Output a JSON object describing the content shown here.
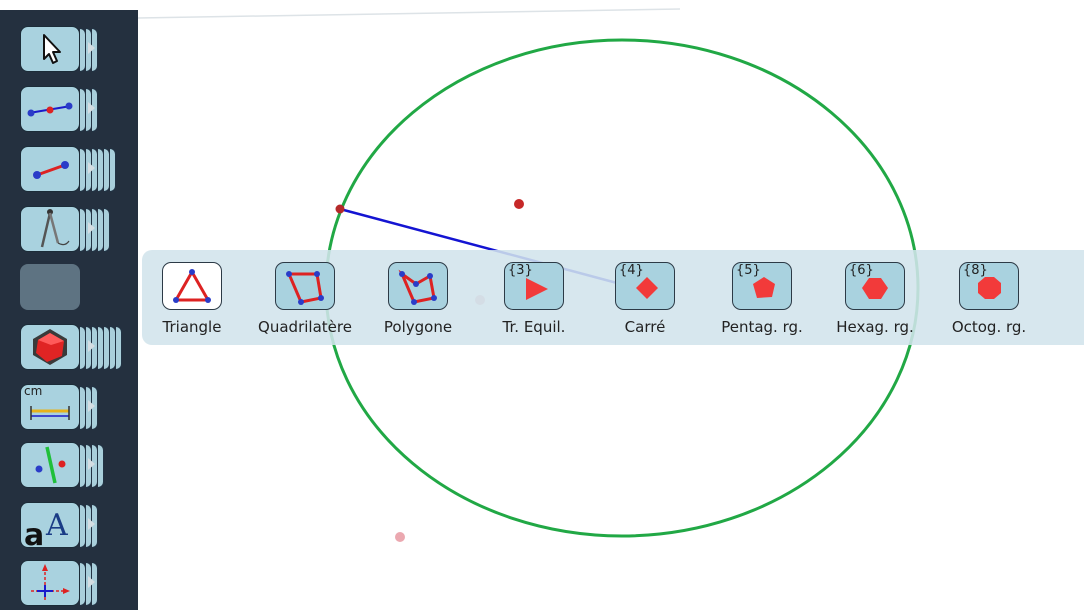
{
  "colors": {
    "sidebar_bg": "#24303f",
    "tool_face": "#a9d2df",
    "circle": "#21a845",
    "segment": "#1414d2",
    "point": "#c62828",
    "shape_red": "#f23a3a",
    "popup_bg": "#d1e4ec"
  },
  "sidebar": {
    "tools": [
      {
        "name": "pointer-tool",
        "icon": "arrow-cursor-icon"
      },
      {
        "name": "point-line-tool",
        "icon": "points-on-line-icon"
      },
      {
        "name": "segment-tool",
        "icon": "segment-icon"
      },
      {
        "name": "compass-tool",
        "icon": "compass-icon"
      },
      {
        "name": "empty-tool",
        "icon": ""
      },
      {
        "name": "polygon-tool",
        "icon": "polyhedron-icon"
      },
      {
        "name": "measure-tool",
        "icon": "ruler-cm-icon",
        "label": "cm"
      },
      {
        "name": "transform-tool",
        "icon": "reflection-icon"
      },
      {
        "name": "text-tool",
        "icon": "text-aA-icon"
      },
      {
        "name": "axes-tool",
        "icon": "axes-icon"
      }
    ]
  },
  "polygon_menu": {
    "items": [
      {
        "label": "Triangle",
        "symbol": "",
        "selected": true,
        "icon": "triangle-icon"
      },
      {
        "label": "Quadrilatère",
        "symbol": "",
        "selected": false,
        "icon": "quadrilateral-icon"
      },
      {
        "label": "Polygone",
        "symbol": "",
        "selected": false,
        "icon": "polygon-icon"
      },
      {
        "label": "Tr. Equil.",
        "symbol": "{3}",
        "selected": false,
        "icon": "equilateral-triangle-icon"
      },
      {
        "label": "Carré",
        "symbol": "{4}",
        "selected": false,
        "icon": "square-icon"
      },
      {
        "label": "Pentag. rg.",
        "symbol": "{5}",
        "selected": false,
        "icon": "pentagon-icon"
      },
      {
        "label": "Hexag. rg.",
        "symbol": "{6}",
        "selected": false,
        "icon": "hexagon-icon"
      },
      {
        "label": "Octog. rg.",
        "symbol": "{8}",
        "selected": false,
        "icon": "octagon-icon"
      }
    ]
  }
}
